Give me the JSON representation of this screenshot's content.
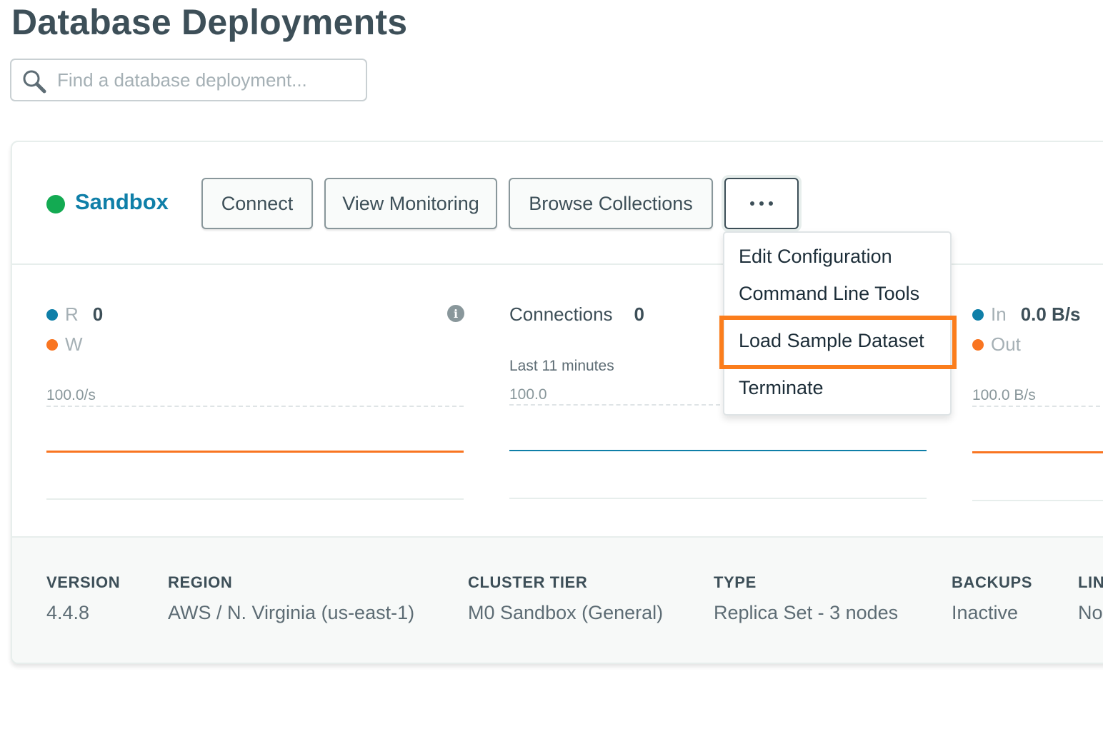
{
  "page": {
    "title": "Database Deployments"
  },
  "search": {
    "placeholder": "Find a database deployment..."
  },
  "cluster": {
    "name": "Sandbox",
    "status_color": "#13aa52",
    "buttons": {
      "connect": "Connect",
      "view_monitoring": "View Monitoring",
      "browse_collections": "Browse Collections",
      "more_icon": "ellipsis-icon"
    },
    "menu": {
      "items": [
        "Edit Configuration",
        "Command Line Tools",
        "Load Sample Dataset",
        "Terminate"
      ],
      "highlighted_item": "Load Sample Dataset",
      "highlight_color": "#fb7d1c"
    },
    "metrics": {
      "opcounters": {
        "read_label": "R",
        "read_value": "0",
        "write_label": "W",
        "scale_label": "100.0/s",
        "read_color": "#0f7fa8",
        "write_color": "#f97521",
        "info_icon": "info-icon"
      },
      "connections": {
        "label": "Connections",
        "value": "0",
        "timespan": "Last 11 minutes",
        "scale_label": "100.0",
        "line_color": "#0f7fa8"
      },
      "network": {
        "in_label": "In",
        "in_value": "0.0 B/s",
        "out_label": "Out",
        "scale_label": "100.0 B/s",
        "in_color": "#0f7fa8",
        "out_color": "#f97521"
      }
    },
    "details": [
      {
        "key": "VERSION",
        "value": "4.4.8"
      },
      {
        "key": "REGION",
        "value": "AWS / N. Virginia (us-east-1)"
      },
      {
        "key": "CLUSTER TIER",
        "value": "M0 Sandbox (General)"
      },
      {
        "key": "TYPE",
        "value": "Replica Set - 3 nodes"
      },
      {
        "key": "BACKUPS",
        "value": "Inactive"
      },
      {
        "key": "LIN",
        "value": "No"
      }
    ]
  }
}
